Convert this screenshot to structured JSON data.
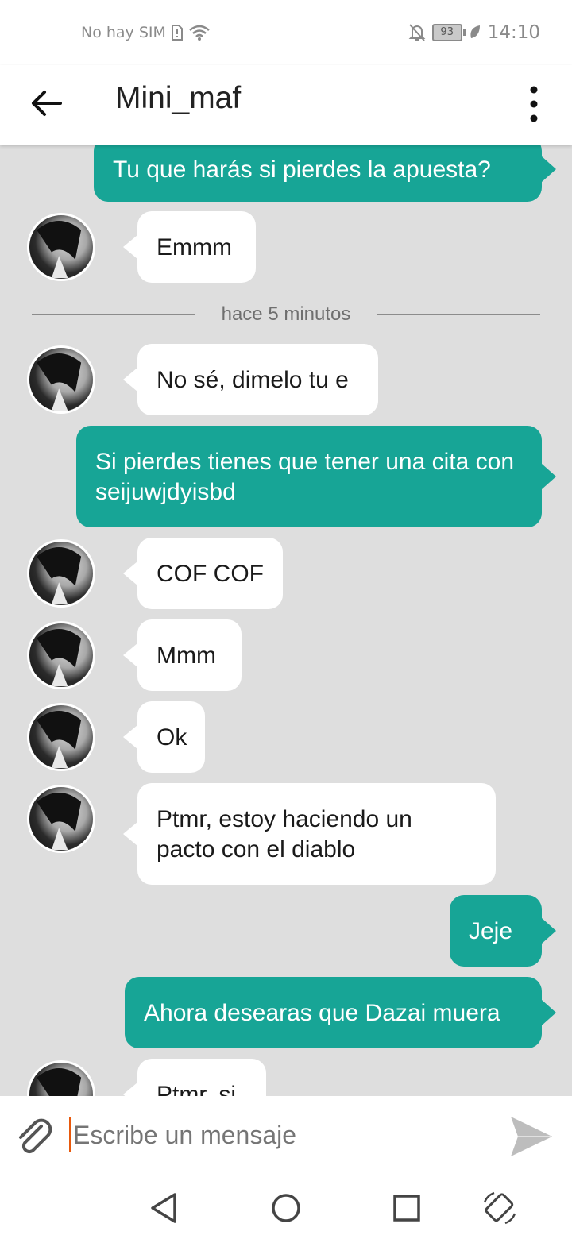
{
  "status_bar": {
    "carrier": "No hay SIM",
    "battery": "93",
    "time": "14:10"
  },
  "header": {
    "title": "Mini_maf"
  },
  "messages": [
    {
      "side": "out",
      "text": "Tu que harás si pierdes la apuesta?"
    },
    {
      "side": "in",
      "text": "Emmm"
    },
    {
      "side": "in",
      "text": "No sé, dimelo tu e"
    },
    {
      "side": "out",
      "text": "Si pierdes tienes que tener una cita con seijuwjdyisbd"
    },
    {
      "side": "in",
      "text": "COF COF"
    },
    {
      "side": "in",
      "text": "Mmm"
    },
    {
      "side": "in",
      "text": "Ok"
    },
    {
      "side": "in",
      "text": "Ptmr, estoy haciendo un pacto con el diablo"
    },
    {
      "side": "out",
      "text": "Jeje"
    },
    {
      "side": "out",
      "text": "Ahora desearas que Dazai muera"
    },
    {
      "side": "in",
      "text": "Ptmr, si"
    }
  ],
  "divider": {
    "text": "hace 5 minutos"
  },
  "composer": {
    "placeholder": "Escribe un mensaje"
  },
  "colors": {
    "outgoing_bubble": "#17a596",
    "incoming_bubble": "#ffffff",
    "chat_background": "#dedede",
    "cursor": "#e8590c"
  }
}
